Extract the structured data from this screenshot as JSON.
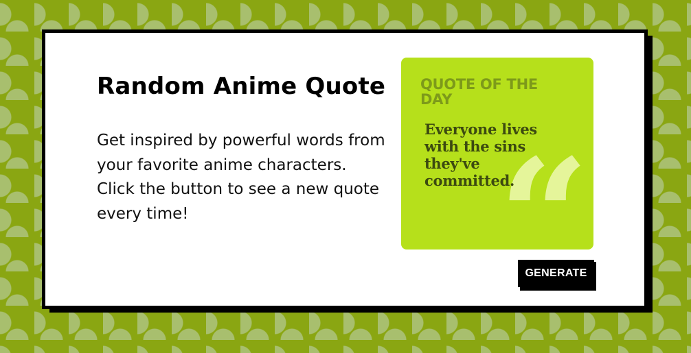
{
  "card": {
    "title": "Random Anime Quote",
    "description": "Get inspired by powerful words from your favorite anime characters. Click the button to see a new quote every time!"
  },
  "quote": {
    "heading": "QUOTE OF THE DAY",
    "text": "Everyone lives with the sins they've committed.",
    "mark": "“"
  },
  "actions": {
    "generate_label": "GENERATE"
  },
  "colors": {
    "background": "#8aa612",
    "pattern": "#a8bf6e",
    "quote_box": "#b6e01b",
    "quote_heading": "#7d9a1a",
    "quote_text": "#3c4a10",
    "button": "#000000"
  }
}
